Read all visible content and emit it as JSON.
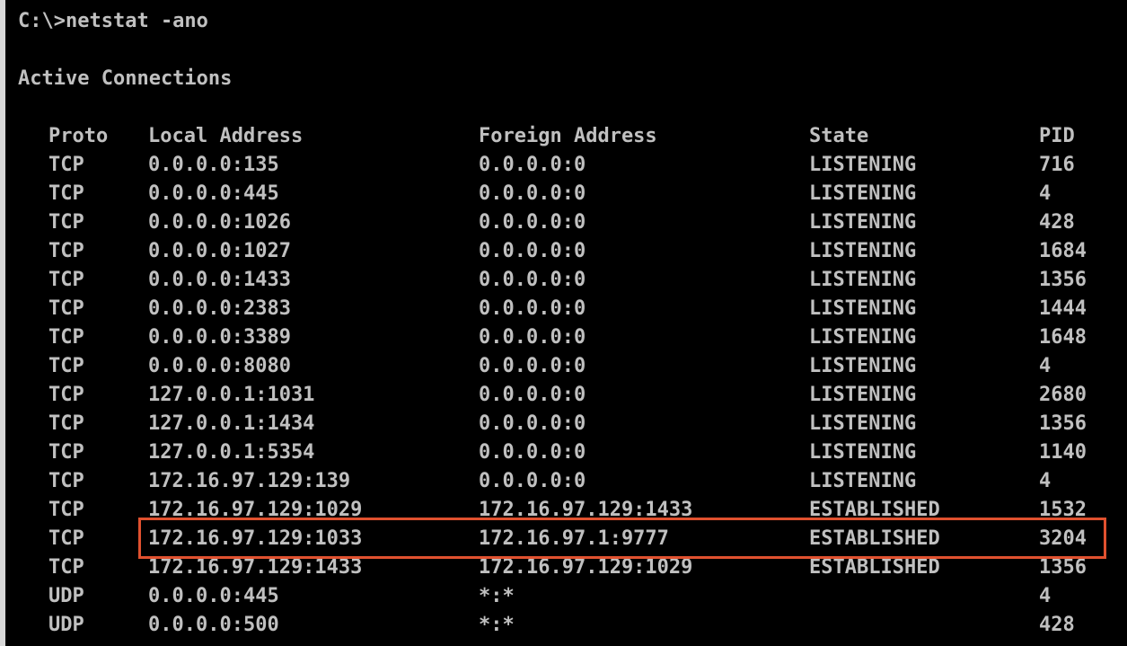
{
  "console": {
    "command": "C:\\>netstat -ano",
    "heading": "Active Connections",
    "columns": {
      "proto": "Proto",
      "local": "Local Address",
      "foreign": "Foreign Address",
      "state": "State",
      "pid": "PID"
    },
    "rows": [
      {
        "proto": "TCP",
        "local": "0.0.0.0:135",
        "foreign": "0.0.0.0:0",
        "state": "LISTENING",
        "pid": "716"
      },
      {
        "proto": "TCP",
        "local": "0.0.0.0:445",
        "foreign": "0.0.0.0:0",
        "state": "LISTENING",
        "pid": "4"
      },
      {
        "proto": "TCP",
        "local": "0.0.0.0:1026",
        "foreign": "0.0.0.0:0",
        "state": "LISTENING",
        "pid": "428"
      },
      {
        "proto": "TCP",
        "local": "0.0.0.0:1027",
        "foreign": "0.0.0.0:0",
        "state": "LISTENING",
        "pid": "1684"
      },
      {
        "proto": "TCP",
        "local": "0.0.0.0:1433",
        "foreign": "0.0.0.0:0",
        "state": "LISTENING",
        "pid": "1356"
      },
      {
        "proto": "TCP",
        "local": "0.0.0.0:2383",
        "foreign": "0.0.0.0:0",
        "state": "LISTENING",
        "pid": "1444"
      },
      {
        "proto": "TCP",
        "local": "0.0.0.0:3389",
        "foreign": "0.0.0.0:0",
        "state": "LISTENING",
        "pid": "1648"
      },
      {
        "proto": "TCP",
        "local": "0.0.0.0:8080",
        "foreign": "0.0.0.0:0",
        "state": "LISTENING",
        "pid": "4"
      },
      {
        "proto": "TCP",
        "local": "127.0.0.1:1031",
        "foreign": "0.0.0.0:0",
        "state": "LISTENING",
        "pid": "2680"
      },
      {
        "proto": "TCP",
        "local": "127.0.0.1:1434",
        "foreign": "0.0.0.0:0",
        "state": "LISTENING",
        "pid": "1356"
      },
      {
        "proto": "TCP",
        "local": "127.0.0.1:5354",
        "foreign": "0.0.0.0:0",
        "state": "LISTENING",
        "pid": "1140"
      },
      {
        "proto": "TCP",
        "local": "172.16.97.129:139",
        "foreign": "0.0.0.0:0",
        "state": "LISTENING",
        "pid": "4"
      },
      {
        "proto": "TCP",
        "local": "172.16.97.129:1029",
        "foreign": "172.16.97.129:1433",
        "state": "ESTABLISHED",
        "pid": "1532"
      },
      {
        "proto": "TCP",
        "local": "172.16.97.129:1033",
        "foreign": "172.16.97.1:9777",
        "state": "ESTABLISHED",
        "pid": "3204"
      },
      {
        "proto": "TCP",
        "local": "172.16.97.129:1433",
        "foreign": "172.16.97.129:1029",
        "state": "ESTABLISHED",
        "pid": "1356"
      },
      {
        "proto": "UDP",
        "local": "0.0.0.0:445",
        "foreign": "*:*",
        "state": "",
        "pid": "4"
      },
      {
        "proto": "UDP",
        "local": "0.0.0.0:500",
        "foreign": "*:*",
        "state": "",
        "pid": "428"
      }
    ]
  },
  "colors": {
    "background": "#000000",
    "text": "#c0c0c0",
    "highlight": "#e0512f"
  }
}
